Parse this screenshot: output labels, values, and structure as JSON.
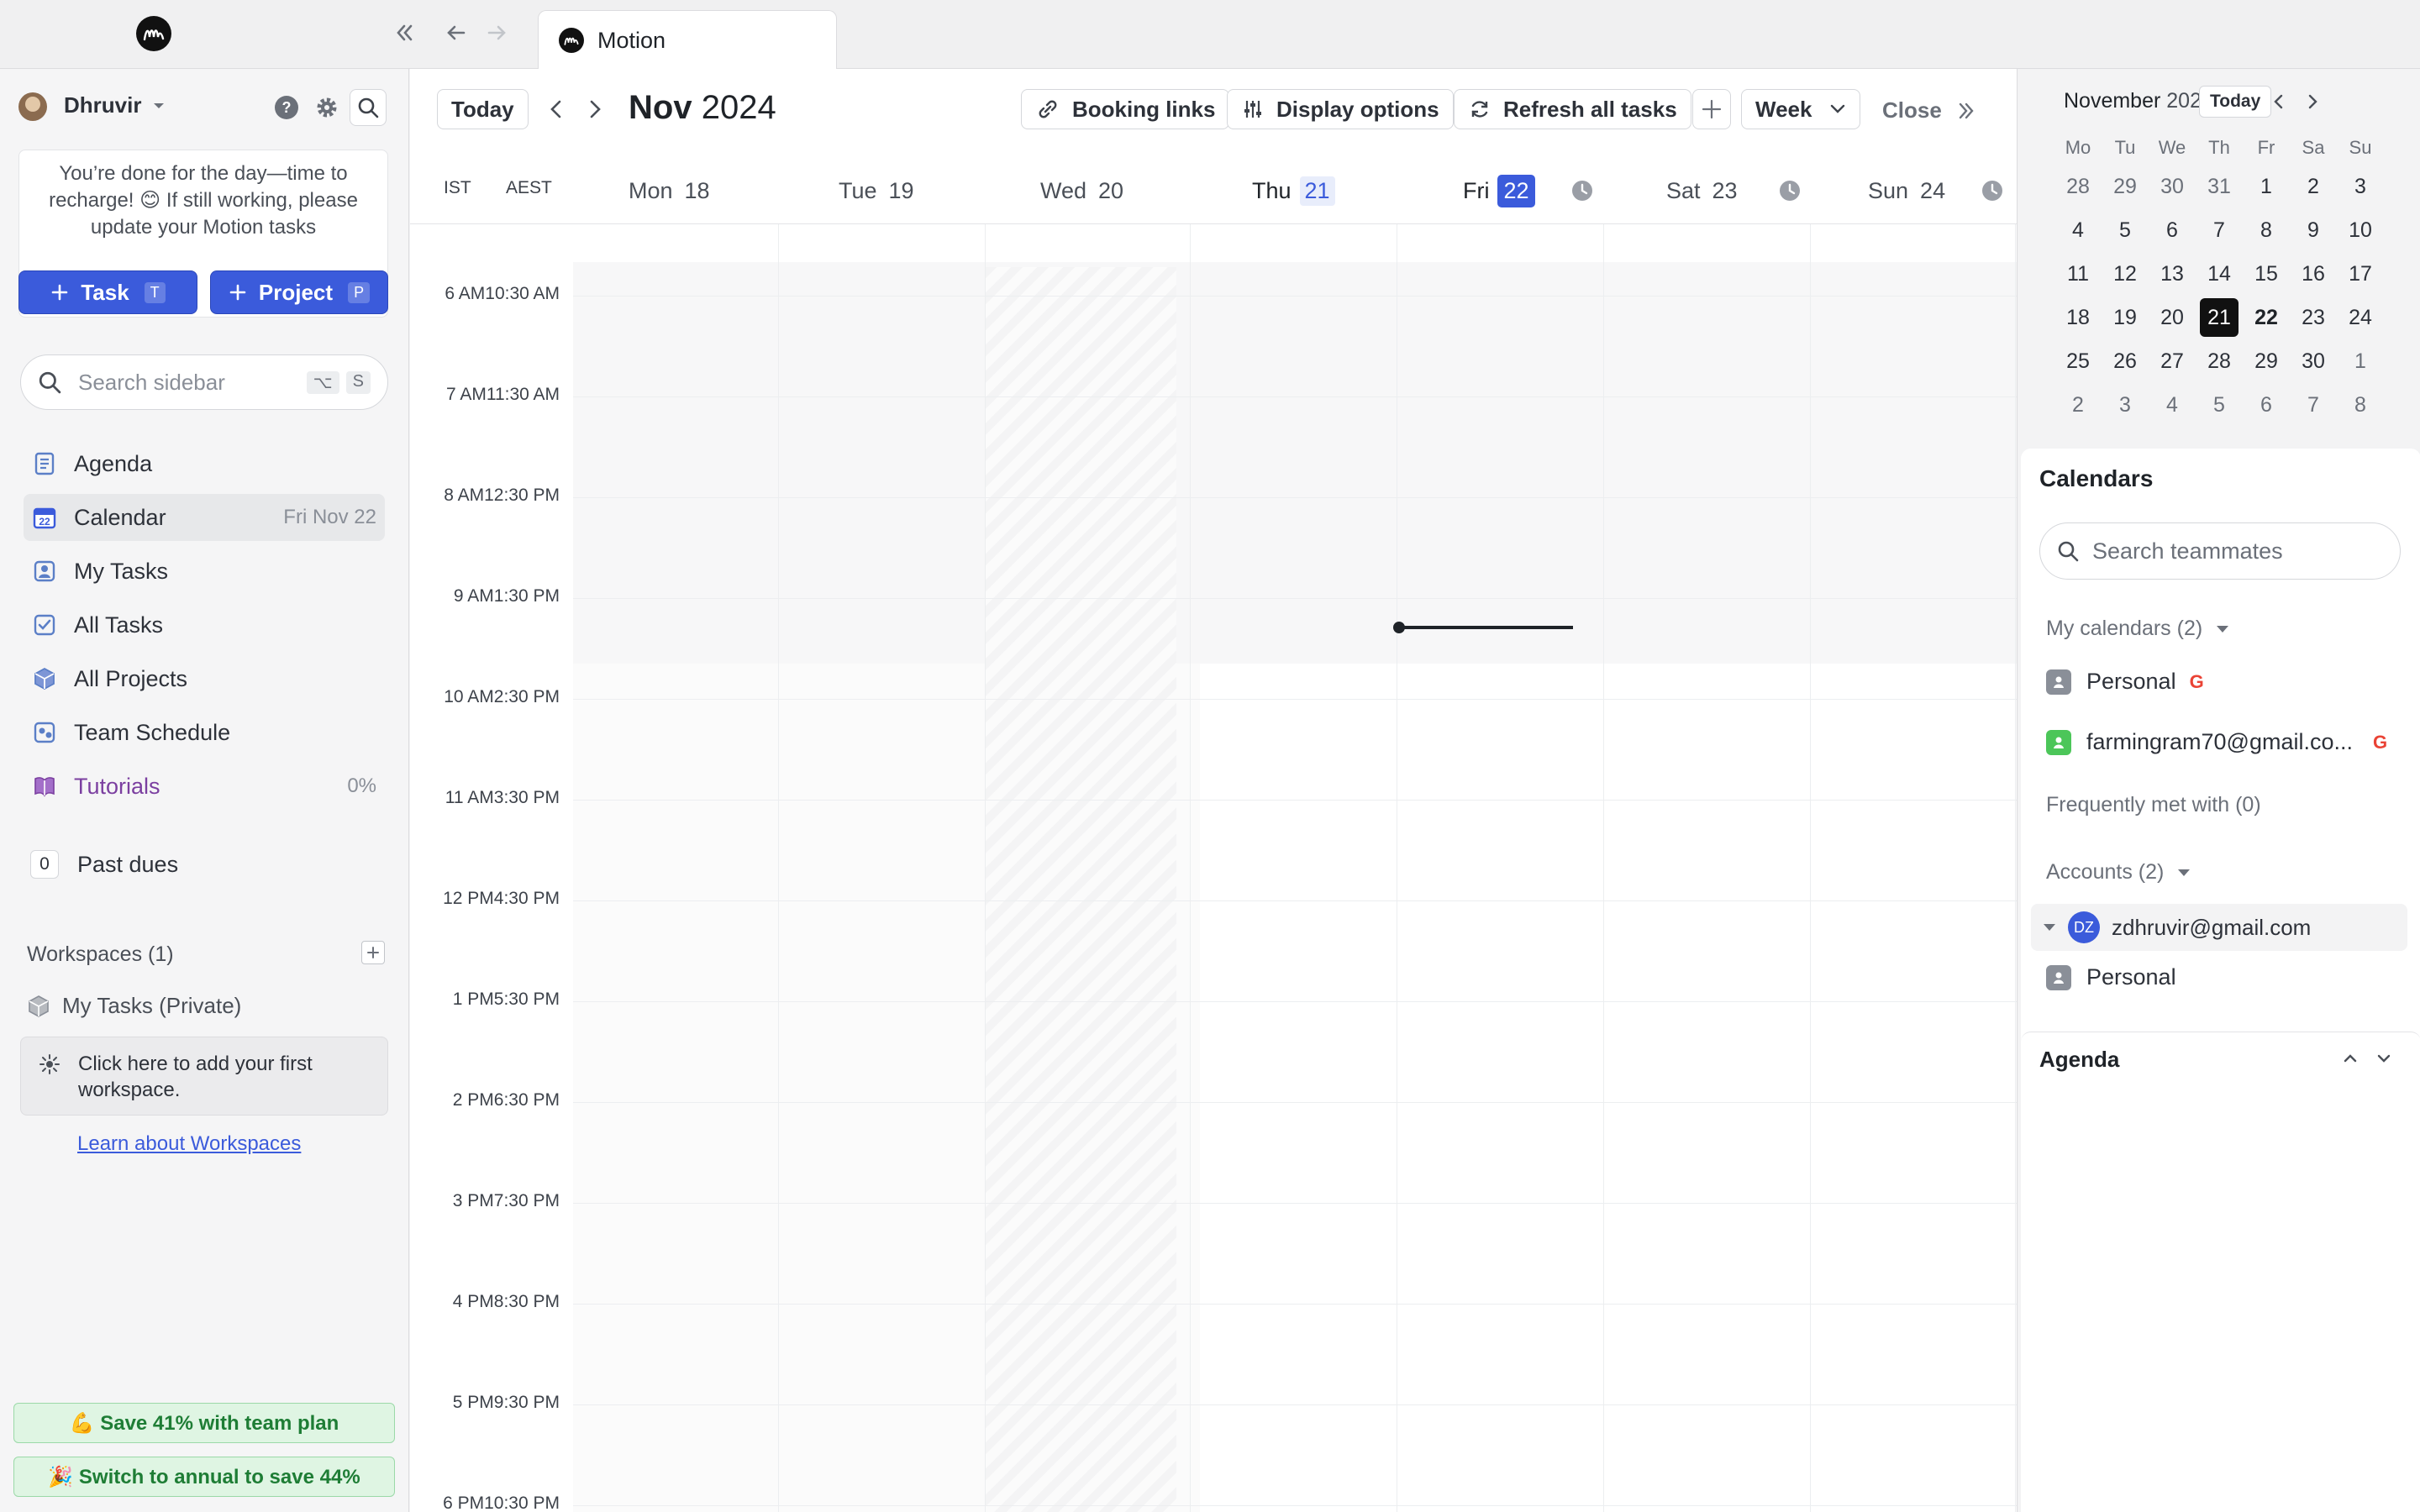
{
  "window": {
    "tab_title": "Motion"
  },
  "sidebar": {
    "user_name": "Dhruvir",
    "notice": "You’re done for the day—time to recharge! 😊 If still working, please update your Motion tasks",
    "task_button": "Task",
    "task_shortcut": "T",
    "project_button": "Project",
    "project_shortcut": "P",
    "search_placeholder": "Search sidebar",
    "search_shortcut_mod": "⌥",
    "search_shortcut_key": "S",
    "nav": {
      "agenda": "Agenda",
      "calendar": "Calendar",
      "calendar_date": "Fri Nov 22",
      "my_tasks": "My Tasks",
      "all_tasks": "All Tasks",
      "all_projects": "All Projects",
      "team_schedule": "Team Schedule",
      "tutorials": "Tutorials",
      "tutorials_progress": "0%"
    },
    "past_dues_count": "0",
    "past_dues_label": "Past dues",
    "workspaces_label": "Workspaces (1)",
    "workspace_item": "My Tasks (Private)",
    "workspace_hint": "Click here to add your first workspace.",
    "learn_link": "Learn about Workspaces",
    "promo_team": "💪 Save 41% with team plan",
    "promo_annual": "🎉 Switch to annual to save 44%"
  },
  "toolbar": {
    "today": "Today",
    "month": "Nov",
    "year": "2024",
    "booking_links": "Booking links",
    "display_options": "Display options",
    "refresh": "Refresh all tasks",
    "view": "Week",
    "close": "Close"
  },
  "calendar": {
    "timezones": [
      "IST",
      "AEST"
    ],
    "days": [
      {
        "name": "Mon",
        "num": "18"
      },
      {
        "name": "Tue",
        "num": "19"
      },
      {
        "name": "Wed",
        "num": "20"
      },
      {
        "name": "Thu",
        "num": "21"
      },
      {
        "name": "Fri",
        "num": "22"
      },
      {
        "name": "Sat",
        "num": "23"
      },
      {
        "name": "Sun",
        "num": "24"
      }
    ],
    "hours": [
      [
        "6 AM",
        "10:30 AM"
      ],
      [
        "7 AM",
        "11:30 AM"
      ],
      [
        "8 AM",
        "12:30 PM"
      ],
      [
        "9 AM",
        "1:30 PM"
      ],
      [
        "10 AM",
        "2:30 PM"
      ],
      [
        "11 AM",
        "3:30 PM"
      ],
      [
        "12 PM",
        "4:30 PM"
      ],
      [
        "1 PM",
        "5:30 PM"
      ],
      [
        "2 PM",
        "6:30 PM"
      ],
      [
        "3 PM",
        "7:30 PM"
      ],
      [
        "4 PM",
        "8:30 PM"
      ],
      [
        "5 PM",
        "9:30 PM"
      ],
      [
        "6 PM",
        "10:30 PM"
      ]
    ]
  },
  "mini_calendar": {
    "month": "November",
    "year": "2024",
    "today_button": "Today",
    "weekdays": [
      "Mo",
      "Tu",
      "We",
      "Th",
      "Fr",
      "Sa",
      "Su"
    ],
    "weeks": [
      [
        "28",
        "29",
        "30",
        "31",
        "1",
        "2",
        "3"
      ],
      [
        "4",
        "5",
        "6",
        "7",
        "8",
        "9",
        "10"
      ],
      [
        "11",
        "12",
        "13",
        "14",
        "15",
        "16",
        "17"
      ],
      [
        "18",
        "19",
        "20",
        "21",
        "22",
        "23",
        "24"
      ],
      [
        "25",
        "26",
        "27",
        "28",
        "29",
        "30",
        "1"
      ],
      [
        "2",
        "3",
        "4",
        "5",
        "6",
        "7",
        "8"
      ]
    ]
  },
  "calendars_panel": {
    "title": "Calendars",
    "search_placeholder": "Search teammates",
    "my_calendars": "My calendars (2)",
    "cal_personal": "Personal",
    "cal_email": "farmingram70@gmail.co...",
    "frequently_met": "Frequently met with (0)",
    "accounts": "Accounts (2)",
    "account_initials": "DZ",
    "account_email": "zdhruvir@gmail.com",
    "account_personal": "Personal"
  },
  "agenda_panel": {
    "title": "Agenda"
  },
  "colors": {
    "accent": "#3b5bdb",
    "today_dark": "#111111",
    "tutorials": "#7b3fa0"
  }
}
